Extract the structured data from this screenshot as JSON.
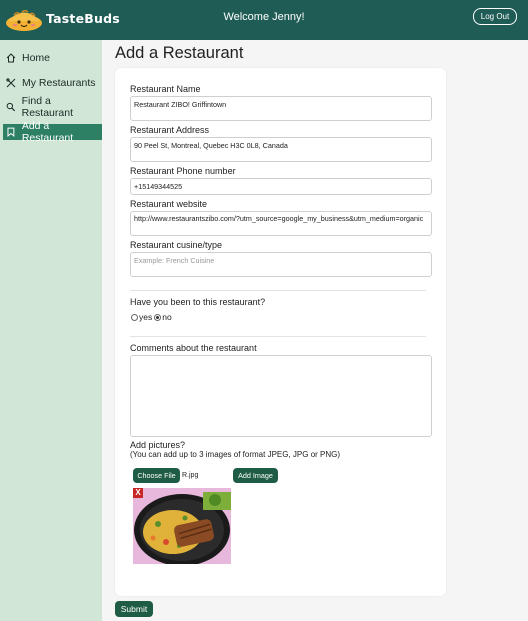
{
  "header": {
    "brand": "TasteBuds",
    "welcome": "Welcome Jenny!",
    "logout_label": "Log Out",
    "bg_color": "#1f5c55"
  },
  "sidebar": {
    "items": [
      {
        "label": "Home",
        "icon": "home-icon"
      },
      {
        "label": "My Restaurants",
        "icon": "utensils-icon"
      },
      {
        "label": "Find a Restaurant",
        "icon": "search-icon"
      },
      {
        "label": "Add a Restaurant",
        "icon": "bookmark-icon",
        "active": true
      }
    ]
  },
  "page": {
    "title": "Add a Restaurant"
  },
  "form": {
    "name_label": "Restaurant Name",
    "name_value": "Restaurant ZIBO! Griffintown",
    "address_label": "Restaurant Address",
    "address_value": "90 Peel St, Montreal, Quebec H3C 0L8, Canada",
    "phone_label": "Restaurant Phone number",
    "phone_value": "+15149344525",
    "website_label": "Restaurant website",
    "website_value": "http://www.restaurantszibo.com/?utm_source=google_my_business&utm_medium=organic",
    "cuisine_label": "Restaurant cusine/type",
    "cuisine_placeholder": "Example: French Cuisine",
    "visited_question": "Have you been to this restaurant?",
    "visited_yes": "yes",
    "visited_no": "no",
    "visited_selected": "no",
    "comments_label": "Comments about the restaurant",
    "comments_value": "",
    "pictures_label": "Add pictures?",
    "pictures_hint": "(You can add up to 3 images of format JPEG, JPG or PNG)",
    "choose_file_label": "Choose File",
    "chosen_file": "R.jpg",
    "add_image_label": "Add Image",
    "remove_image_label": "X",
    "submit_label": "Submit"
  }
}
